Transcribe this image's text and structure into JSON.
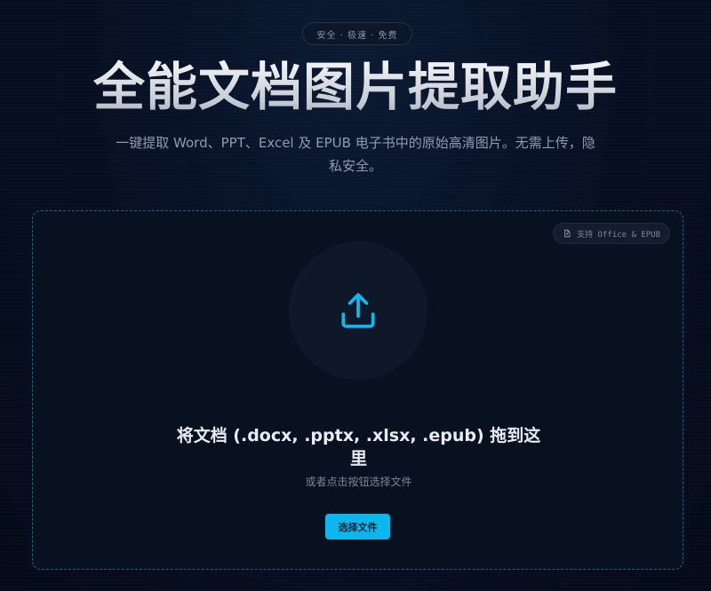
{
  "header": {
    "badge": "安全 · 极速 · 免费",
    "title": "全能文档图片提取助手",
    "subtitle": "一键提取 Word、PPT、Excel 及 EPUB 电子书中的原始高清图片。无需上传，隐私安全。"
  },
  "dropzone": {
    "support_badge": "支持 Office & EPUB",
    "title": "将文档 (.docx, .pptx, .xlsx, .epub) 拖到这里",
    "hint": "或者点击按钮选择文件",
    "choose_button": "选择文件",
    "icons": {
      "support": "file-icon",
      "upload": "upload-icon"
    }
  },
  "colors": {
    "accent": "#0eb6ee",
    "background": "#060e1f",
    "dropzone_border": "#1f5f80"
  }
}
